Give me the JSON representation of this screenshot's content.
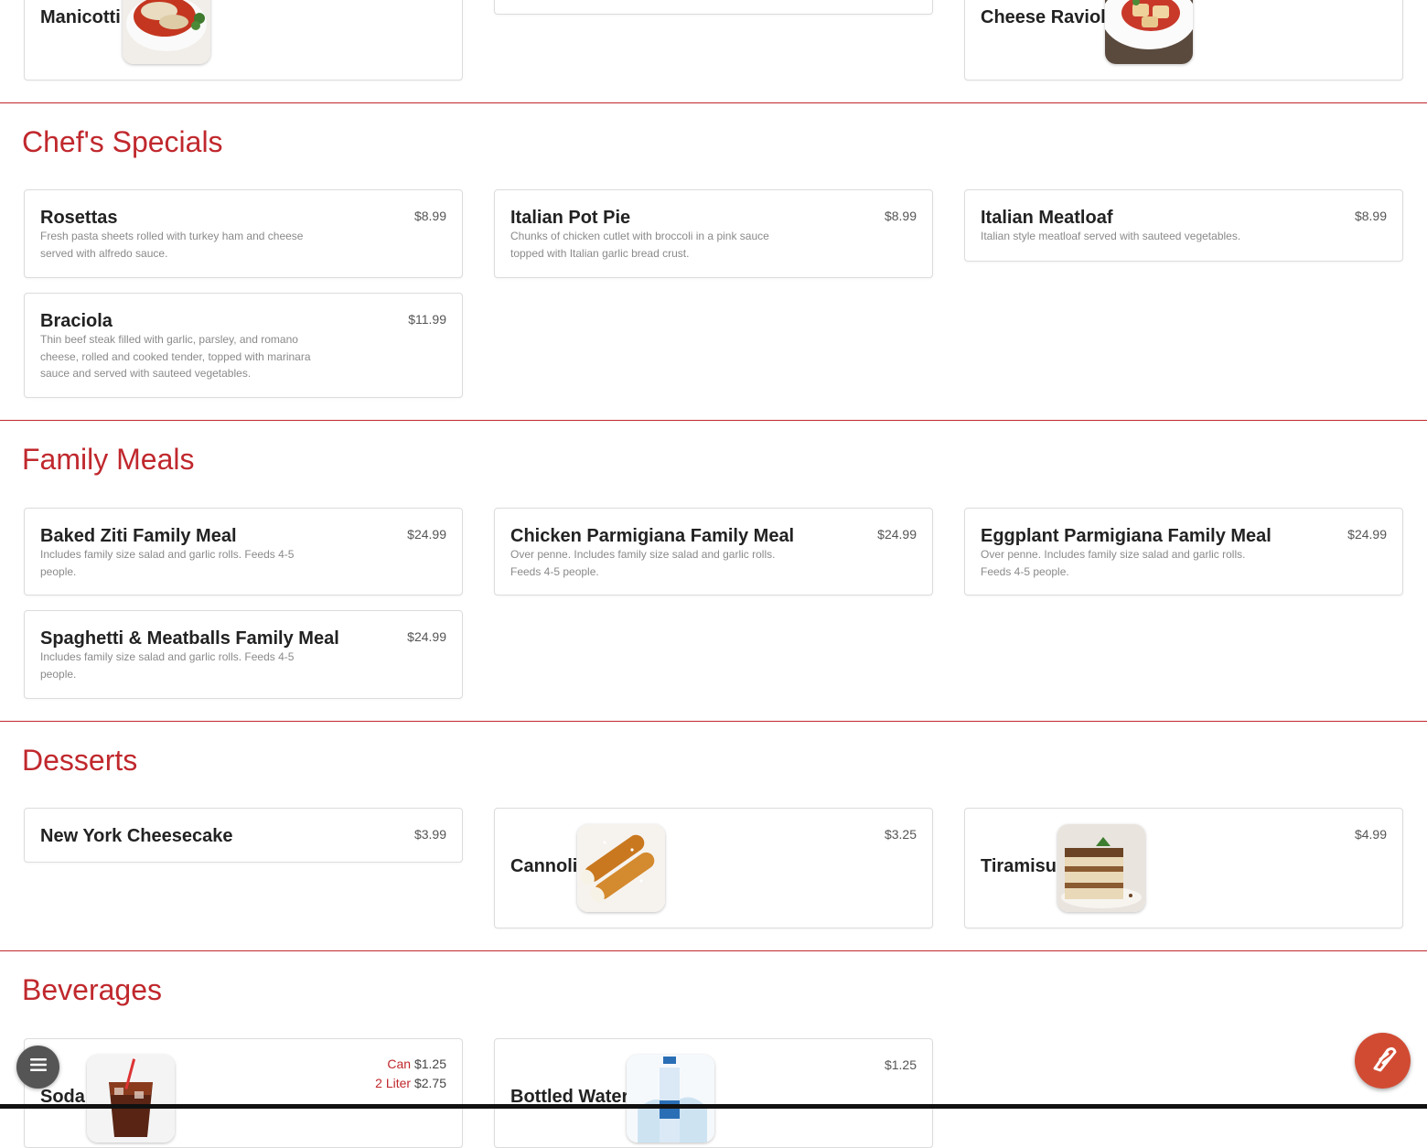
{
  "top_items": {
    "manicotti": {
      "name": "Manicotti"
    },
    "cheese_ravioli": {
      "name": "Cheese Ravioli"
    }
  },
  "chefs_specials": {
    "title": "Chef's Specials",
    "items": [
      {
        "name": "Rosettas",
        "price": "$8.99",
        "desc": "Fresh pasta sheets rolled with turkey ham and cheese served with alfredo sauce."
      },
      {
        "name": "Italian Pot Pie",
        "price": "$8.99",
        "desc": "Chunks of chicken cutlet with broccoli in a pink sauce topped with Italian garlic bread crust."
      },
      {
        "name": "Italian Meatloaf",
        "price": "$8.99",
        "desc": "Italian style meatloaf served with sauteed vegetables."
      },
      {
        "name": "Braciola",
        "price": "$11.99",
        "desc": "Thin beef steak filled with garlic, parsley, and romano cheese, rolled and cooked tender, topped with marinara sauce and served with sauteed vegetables."
      }
    ]
  },
  "family_meals": {
    "title": "Family Meals",
    "items": [
      {
        "name": "Baked Ziti Family Meal",
        "price": "$24.99",
        "desc": "Includes family size salad and garlic rolls. Feeds 4-5 people."
      },
      {
        "name": "Chicken Parmigiana Family Meal",
        "price": "$24.99",
        "desc": "Over penne. Includes family size salad and garlic rolls. Feeds 4-5 people."
      },
      {
        "name": "Eggplant Parmigiana Family Meal",
        "price": "$24.99",
        "desc": "Over penne. Includes family size salad and garlic rolls. Feeds 4-5 people."
      },
      {
        "name": "Spaghetti & Meatballs Family Meal",
        "price": "$24.99",
        "desc": "Includes family size salad and garlic rolls. Feeds 4-5 people."
      }
    ]
  },
  "desserts": {
    "title": "Desserts",
    "items": [
      {
        "name": "New York Cheesecake",
        "price": "$3.99"
      },
      {
        "name": "Cannoli",
        "price": "$3.25"
      },
      {
        "name": "Tiramisu",
        "price": "$4.99"
      }
    ]
  },
  "beverages": {
    "title": "Beverages",
    "items": [
      {
        "name": "Soda",
        "prices": [
          {
            "label": "Can",
            "price": "$1.25"
          },
          {
            "label": "2 Liter",
            "price": "$2.75"
          }
        ]
      },
      {
        "name": "Bottled Water",
        "price": "$1.25"
      }
    ]
  },
  "icons": {
    "menu_button": "hamburger-menu-icon",
    "order_button": "order-food-icon"
  },
  "colors": {
    "accent": "#c0282d",
    "order_button": "#d14b33",
    "menu_button": "#555555"
  }
}
